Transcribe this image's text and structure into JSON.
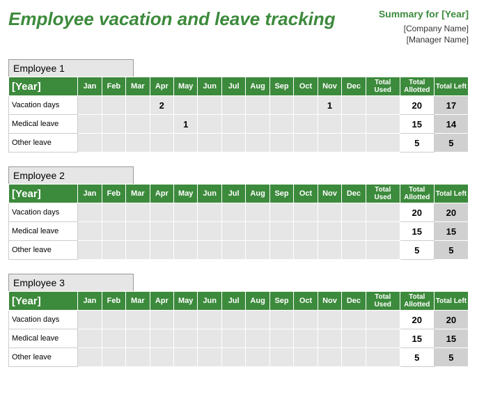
{
  "title": "Employee vacation and leave tracking",
  "summary_label": "Summary for [Year]",
  "company": "[Company Name]",
  "manager": "[Manager Name]",
  "year_header": "[Year]",
  "months": [
    "Jan",
    "Feb",
    "Mar",
    "Apr",
    "May",
    "Jun",
    "Jul",
    "Aug",
    "Sep",
    "Oct",
    "Nov",
    "Dec"
  ],
  "totals_headers": [
    "Total Used",
    "Total Allotted",
    "Total Left"
  ],
  "row_labels": [
    "Vacation days",
    "Medical leave",
    "Other leave"
  ],
  "employees": [
    {
      "name": "Employee 1",
      "rows": [
        {
          "months": [
            "",
            "",
            "",
            "2",
            "",
            "",
            "",
            "",
            "",
            "",
            "1",
            ""
          ],
          "used": "",
          "allotted": "20",
          "left": "17"
        },
        {
          "months": [
            "",
            "",
            "",
            "",
            "1",
            "",
            "",
            "",
            "",
            "",
            "",
            ""
          ],
          "used": "",
          "allotted": "15",
          "left": "14"
        },
        {
          "months": [
            "",
            "",
            "",
            "",
            "",
            "",
            "",
            "",
            "",
            "",
            "",
            ""
          ],
          "used": "",
          "allotted": "5",
          "left": "5"
        }
      ]
    },
    {
      "name": "Employee 2",
      "rows": [
        {
          "months": [
            "",
            "",
            "",
            "",
            "",
            "",
            "",
            "",
            "",
            "",
            "",
            ""
          ],
          "used": "",
          "allotted": "20",
          "left": "20"
        },
        {
          "months": [
            "",
            "",
            "",
            "",
            "",
            "",
            "",
            "",
            "",
            "",
            "",
            ""
          ],
          "used": "",
          "allotted": "15",
          "left": "15"
        },
        {
          "months": [
            "",
            "",
            "",
            "",
            "",
            "",
            "",
            "",
            "",
            "",
            "",
            ""
          ],
          "used": "",
          "allotted": "5",
          "left": "5"
        }
      ]
    },
    {
      "name": "Employee 3",
      "rows": [
        {
          "months": [
            "",
            "",
            "",
            "",
            "",
            "",
            "",
            "",
            "",
            "",
            "",
            ""
          ],
          "used": "",
          "allotted": "20",
          "left": "20"
        },
        {
          "months": [
            "",
            "",
            "",
            "",
            "",
            "",
            "",
            "",
            "",
            "",
            "",
            ""
          ],
          "used": "",
          "allotted": "15",
          "left": "15"
        },
        {
          "months": [
            "",
            "",
            "",
            "",
            "",
            "",
            "",
            "",
            "",
            "",
            "",
            ""
          ],
          "used": "",
          "allotted": "5",
          "left": "5"
        }
      ]
    }
  ]
}
